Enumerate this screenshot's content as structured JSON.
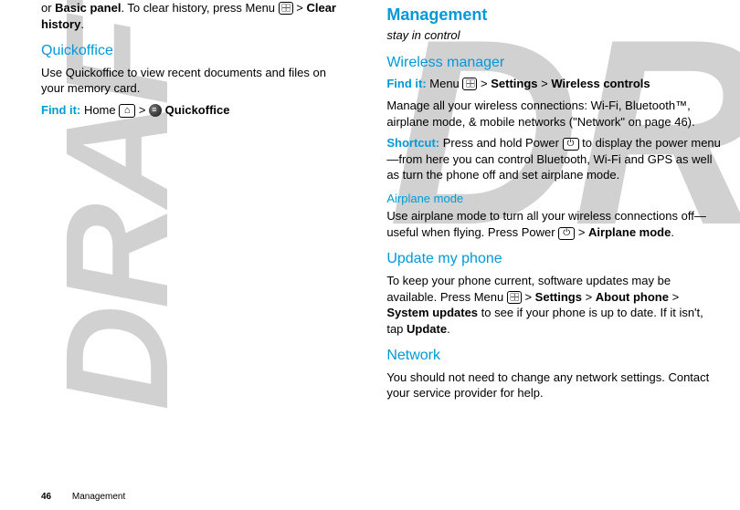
{
  "left": {
    "intro_pre": "or ",
    "intro_bold1": "Basic panel",
    "intro_mid": ". To clear history, press Menu ",
    "intro_gt": " > ",
    "intro_bold2": "Clear history",
    "intro_end": ".",
    "quickoffice_heading": "Quickoffice",
    "quickoffice_desc": "Use Quickoffice to view recent documents and files on your memory card.",
    "findit_label": "Find it:",
    "findit_home": " Home ",
    "findit_gt": " > ",
    "findit_target": " Quickoffice"
  },
  "right": {
    "management_heading": "Management",
    "management_tagline": "stay in control",
    "wm_heading": "Wireless manager",
    "findit_label": "Find it:",
    "findit_menu": " Menu ",
    "findit_gt1": " > ",
    "findit_settings": "Settings",
    "findit_gt2": " > ",
    "findit_wireless": "Wireless controls",
    "wm_desc": "Manage all your wireless connections: Wi-Fi, Bluetooth™, airplane mode, & mobile networks (\"Network\" on page 46).",
    "shortcut_label": "Shortcut:",
    "shortcut_pre": " Press and hold Power ",
    "shortcut_post": " to display the power menu—from here you can control Bluetooth, Wi-Fi and GPS as well as turn the phone off and set airplane mode.",
    "airplane_heading": "Airplane mode",
    "airplane_pre": "Use airplane mode to turn all your wireless connections off—useful when flying. Press Power ",
    "airplane_gt": " > ",
    "airplane_bold": "Airplane mode",
    "airplane_end": ".",
    "update_heading": "Update my phone",
    "update_pre": "To keep your phone current, software updates may be available. Press Menu ",
    "update_gt1": " > ",
    "update_settings": "Settings",
    "update_gt2": " > ",
    "update_about": "About phone",
    "update_gt3": " > ",
    "update_system": "System updates",
    "update_mid": " to see if your phone is up to date. If it isn't, tap ",
    "update_update": "Update",
    "update_end": ".",
    "network_heading": "Network",
    "network_desc": "You should not need to change any network settings. Contact your service provider for help."
  },
  "footer": {
    "page": "46",
    "section": "Management"
  },
  "watermark": "DRAFT"
}
